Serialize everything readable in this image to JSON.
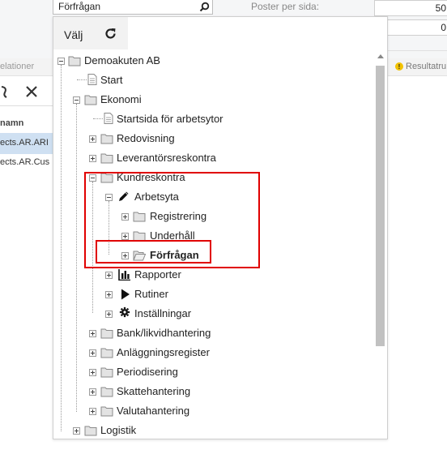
{
  "search": {
    "value": "Förfrågan"
  },
  "background": {
    "fields": {
      "posts_label": "Poster per sida:",
      "posts_value": "50",
      "second_value": "0"
    },
    "relations_tab": "elationer",
    "result_tab": "Resultatru",
    "column_header": "namn",
    "rows": [
      "ects.AR.ARI",
      "ects.AR.Cus"
    ]
  },
  "panel": {
    "choose_label": "Välj",
    "tree": {
      "root": "Demoakuten AB",
      "start": "Start",
      "ekonomi": "Ekonomi",
      "startsida": "Startsida för arbetsytor",
      "redovisning": "Redovisning",
      "leverantorsreskontra": "Leverantörsreskontra",
      "kundreskontra": "Kundreskontra",
      "arbetsyta": "Arbetsyta",
      "registrering": "Registrering",
      "underhall": "Underhåll",
      "forfragan": "Förfrågan",
      "rapporter": "Rapporter",
      "rutiner": "Rutiner",
      "installningar": "Inställningar",
      "bank": "Bank/likvidhantering",
      "anlaggning": "Anläggningsregister",
      "periodisering": "Periodisering",
      "skatt": "Skattehantering",
      "valuta": "Valutahantering",
      "logistik": "Logistik"
    }
  },
  "colors": {
    "highlight": "#e00000",
    "selected_row": "#cfe0f2",
    "warning": "#f2c200"
  }
}
